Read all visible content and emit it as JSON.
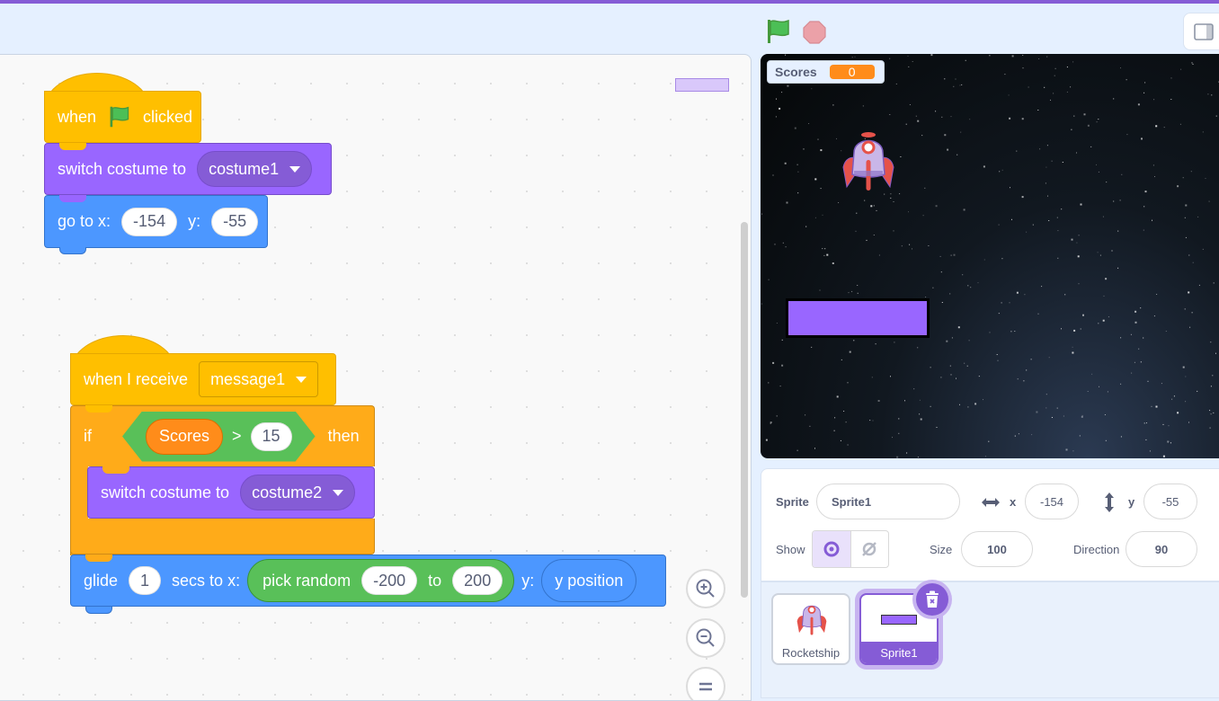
{
  "header": {
    "green_flag": "green-flag-icon",
    "stop": "stop-icon",
    "layout_toggle": "small-stage-layout-icon"
  },
  "scripts": [
    {
      "hat": {
        "text_before": "when",
        "icon": "green-flag-icon",
        "text_after": "clicked"
      },
      "blocks": [
        {
          "text": "switch costume to",
          "dropdown": "costume1"
        },
        {
          "text": "go to x:",
          "x": "-154",
          "y_label": "y:",
          "y": "-55"
        }
      ]
    },
    {
      "hat": {
        "text": "when I receive",
        "dropdown": "message1"
      },
      "if_block": {
        "label": "if",
        "condition": {
          "variable": "Scores",
          "operator": ">",
          "value": "15"
        },
        "then_label": "then",
        "inner": {
          "text": "switch costume to",
          "dropdown": "costume2"
        }
      },
      "glide": {
        "label": "glide",
        "secs": "1",
        "secs_label": "secs to x:",
        "random_label": "pick random",
        "from": "-200",
        "to_label": "to",
        "to": "200",
        "y_label": "y:",
        "y_reporter": "y position"
      }
    }
  ],
  "stage": {
    "monitor": {
      "label": "Scores",
      "value": "0"
    }
  },
  "sprite_info": {
    "sprite_label": "Sprite",
    "sprite_name": "Sprite1",
    "x_label": "x",
    "x_value": "-154",
    "y_label": "y",
    "y_value": "-55",
    "show_label": "Show",
    "size_label": "Size",
    "size_value": "100",
    "direction_label": "Direction",
    "direction_value": "90"
  },
  "sprites": [
    {
      "name": "Rocketship",
      "selected": false
    },
    {
      "name": "Sprite1",
      "selected": true
    }
  ],
  "colors": {
    "accent": "#855cd6",
    "events": "#ffbf00",
    "looks": "#9966ff",
    "motion": "#4c97ff",
    "control": "#ffab19",
    "operators": "#59c059",
    "variables": "#ff8c1a"
  }
}
